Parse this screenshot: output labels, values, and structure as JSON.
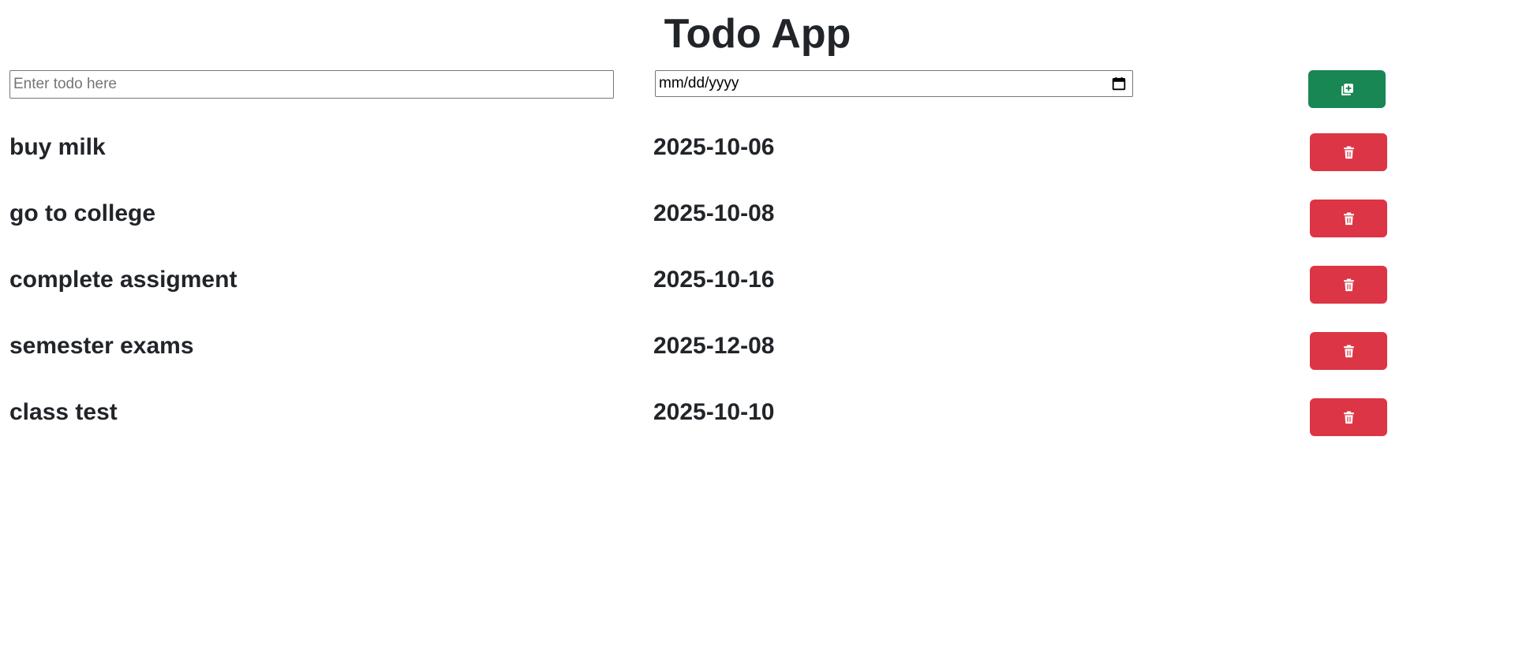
{
  "app": {
    "title": "Todo App"
  },
  "form": {
    "todo_placeholder": "Enter todo here",
    "todo_value": "",
    "date_placeholder": "mm/dd/yyyy",
    "add_icon": "add-square-icon"
  },
  "todos": [
    {
      "name": "buy milk",
      "date": "2025-10-06"
    },
    {
      "name": "go to college",
      "date": "2025-10-08"
    },
    {
      "name": "complete assigment",
      "date": "2025-10-16"
    },
    {
      "name": "semester exams",
      "date": "2025-12-08"
    },
    {
      "name": "class test",
      "date": "2025-10-10"
    }
  ],
  "colors": {
    "add_button": "#198754",
    "delete_button": "#dc3545",
    "text": "#212529"
  },
  "icons": {
    "delete": "trash-icon",
    "calendar": "calendar-icon"
  }
}
